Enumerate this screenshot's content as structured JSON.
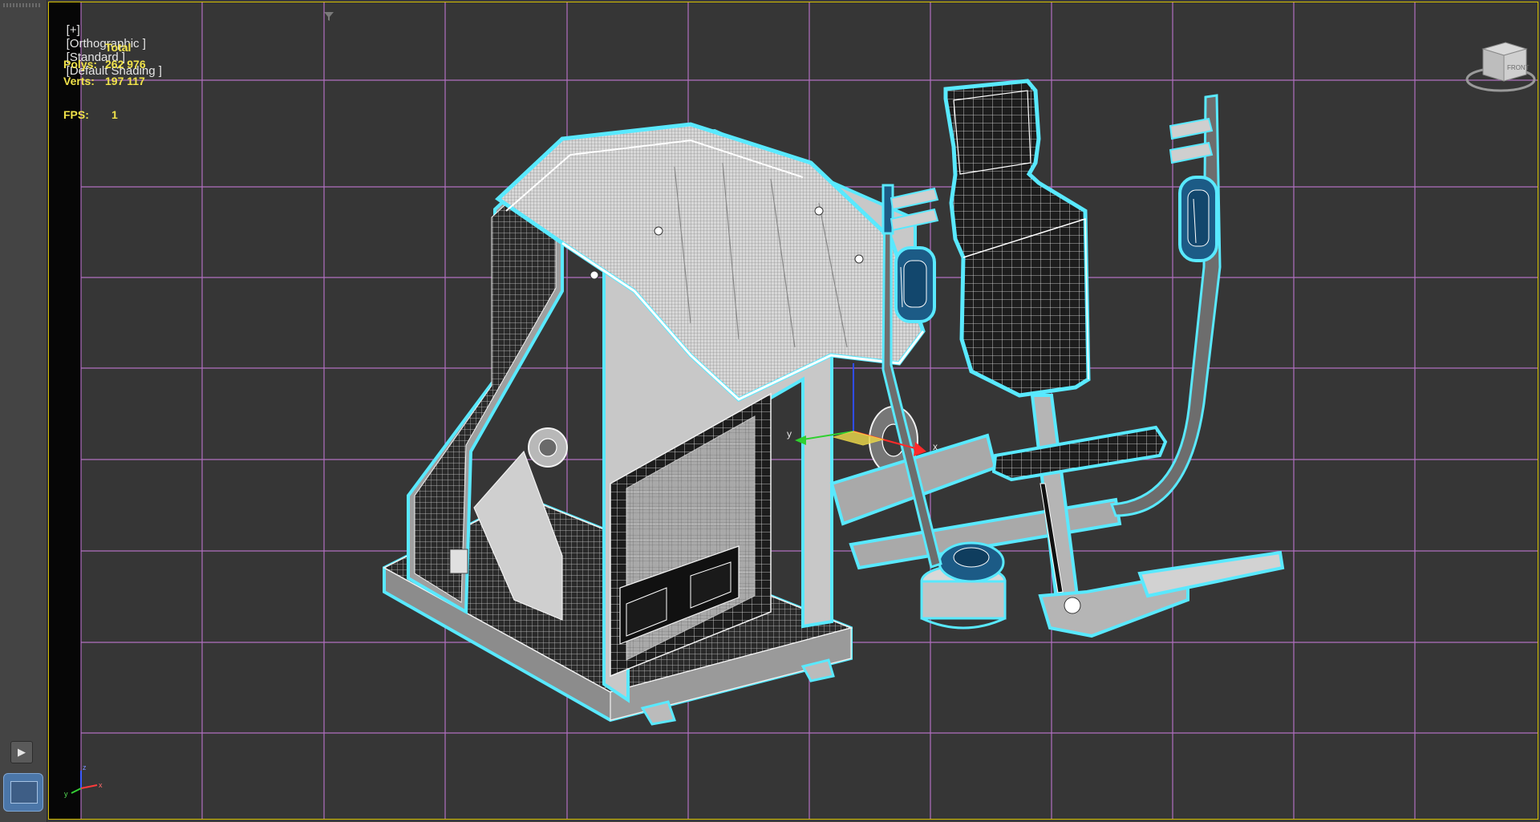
{
  "viewport": {
    "label": {
      "plus": "[+]",
      "view": "[Orthographic ]",
      "mode": "[Standard ]",
      "shading": "[Default Shading ]"
    },
    "stats": {
      "total_label": "Total",
      "polys_label": "Polys:",
      "polys_value": "262 976",
      "verts_label": "Verts:",
      "verts_value": "197 117",
      "fps_label": "FPS:",
      "fps_value": "1"
    },
    "gizmo_axes": {
      "x": "x",
      "y": "y",
      "z": "z"
    },
    "viewcube": {
      "face_label": "FRONT"
    }
  },
  "colors": {
    "viewport_border": "#d6c000",
    "grid": "#c77ad9",
    "selection": "#59e9ff",
    "wire": "#f2f2f2",
    "stats_text": "#f0e24a"
  },
  "icons": {
    "play": "play-icon",
    "filter": "filter-icon",
    "viewcube": "viewcube-icon",
    "tripod": "axis-tripod-icon"
  }
}
